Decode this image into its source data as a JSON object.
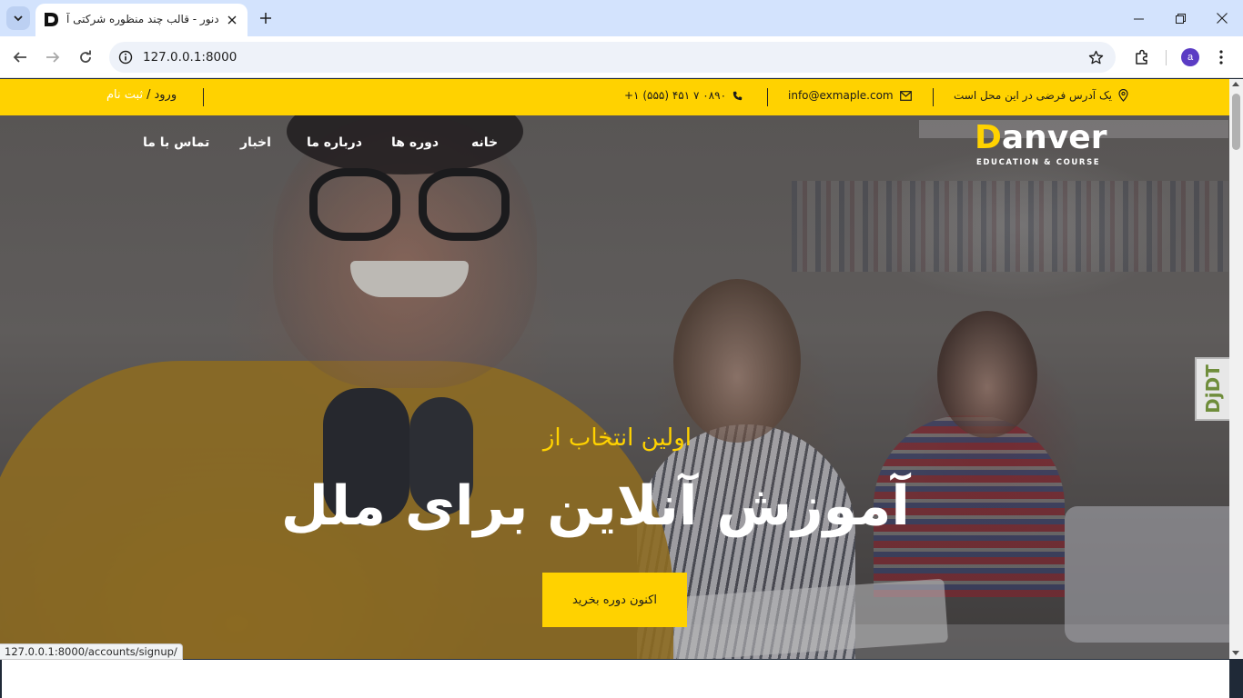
{
  "browser": {
    "tab_title": "دنور - قالب چند منظوره شرکتی آ",
    "url": "127.0.0.1:8000",
    "profile_initial": "a",
    "status_url": "127.0.0.1:8000/accounts/signup/"
  },
  "topbar": {
    "address": "یک آدرس فرضی در این محل است",
    "email": "info@exmaple.com",
    "phone": "+۱ (۵۵۵) ۴۵۱ ۷ ۰۸۹۰",
    "login": "ورود",
    "separator": "/",
    "signup": "ثبت نام"
  },
  "logo": {
    "word_initial": "D",
    "word_rest": "anver",
    "tagline": "EDUCATION & COURSE"
  },
  "nav": {
    "items": [
      "خانه",
      "دوره ها",
      "درباره ما",
      "اخبار",
      "تماس با ما"
    ]
  },
  "hero": {
    "subtitle": "اولین انتخاب از",
    "title": "آموزش آنلاین برای ملل",
    "button": "اکنون دوره بخرید"
  },
  "side_badge": "DjDT",
  "colors": {
    "accent": "#ffd200",
    "chrome_tabbar": "#d3e3fd",
    "avatar": "#5b3cc4"
  }
}
